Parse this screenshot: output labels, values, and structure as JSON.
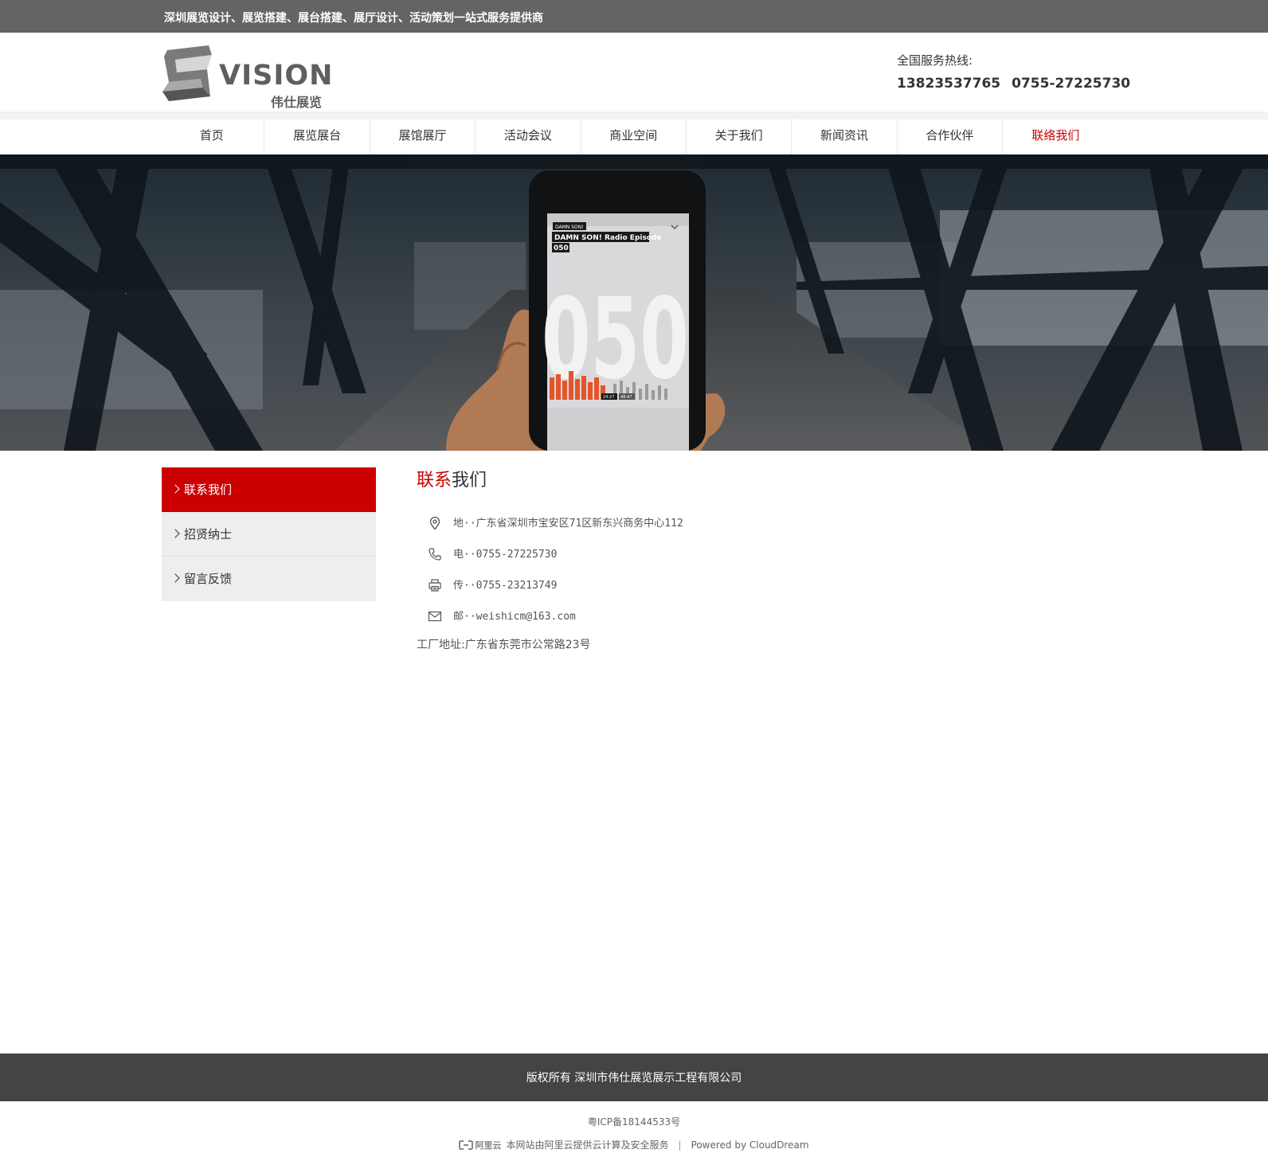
{
  "topbar": {
    "slogan": "深圳展览设计、展览搭建、展台搭建、展厅设计、活动策划一站式服务提供商"
  },
  "header": {
    "logo_word": "VISION",
    "logo_sub": "伟仕展览",
    "hotline_label": "全国服务热线:",
    "hotline_1": "13823537765",
    "hotline_2": "0755-27225730"
  },
  "nav": {
    "items": [
      {
        "label": "首页"
      },
      {
        "label": "展览展台"
      },
      {
        "label": "展馆展厅"
      },
      {
        "label": "活动会议"
      },
      {
        "label": "商业空间"
      },
      {
        "label": "关于我们"
      },
      {
        "label": "新闻资讯"
      },
      {
        "label": "合作伙伴"
      },
      {
        "label": "联络我们"
      }
    ],
    "active_color": "#cc0000"
  },
  "banner": {
    "app_tag": "DAMN SON!",
    "app_title_1": "DAMN SON! Radio Episode",
    "app_title_2": "050",
    "big_number": "050",
    "time_elapsed": "24:27",
    "time_total": "48:47"
  },
  "sidebar": {
    "items": [
      {
        "label": "联系我们"
      },
      {
        "label": "招贤纳士"
      },
      {
        "label": "留言反馈"
      }
    ],
    "active_color": "#cc0000"
  },
  "content": {
    "title_red": "联系",
    "title_rest": "我们",
    "address": "地··广东省深圳市宝安区71区新东兴商务中心112",
    "phone": "电··0755-27225730",
    "fax": "传··0755-23213749",
    "email": "邮··weishicm@163.com",
    "factory": "工厂地址:广东省东莞市公常路23号"
  },
  "footer": {
    "copyright": "版权所有 深圳市伟仕展览展示工程有限公司",
    "icp": "粤ICP备18144533号",
    "aliyun_logo": "阿里云",
    "aliyun_text": "本网站由阿里云提供云计算及安全服务",
    "powered": "Powered by CloudDream"
  }
}
